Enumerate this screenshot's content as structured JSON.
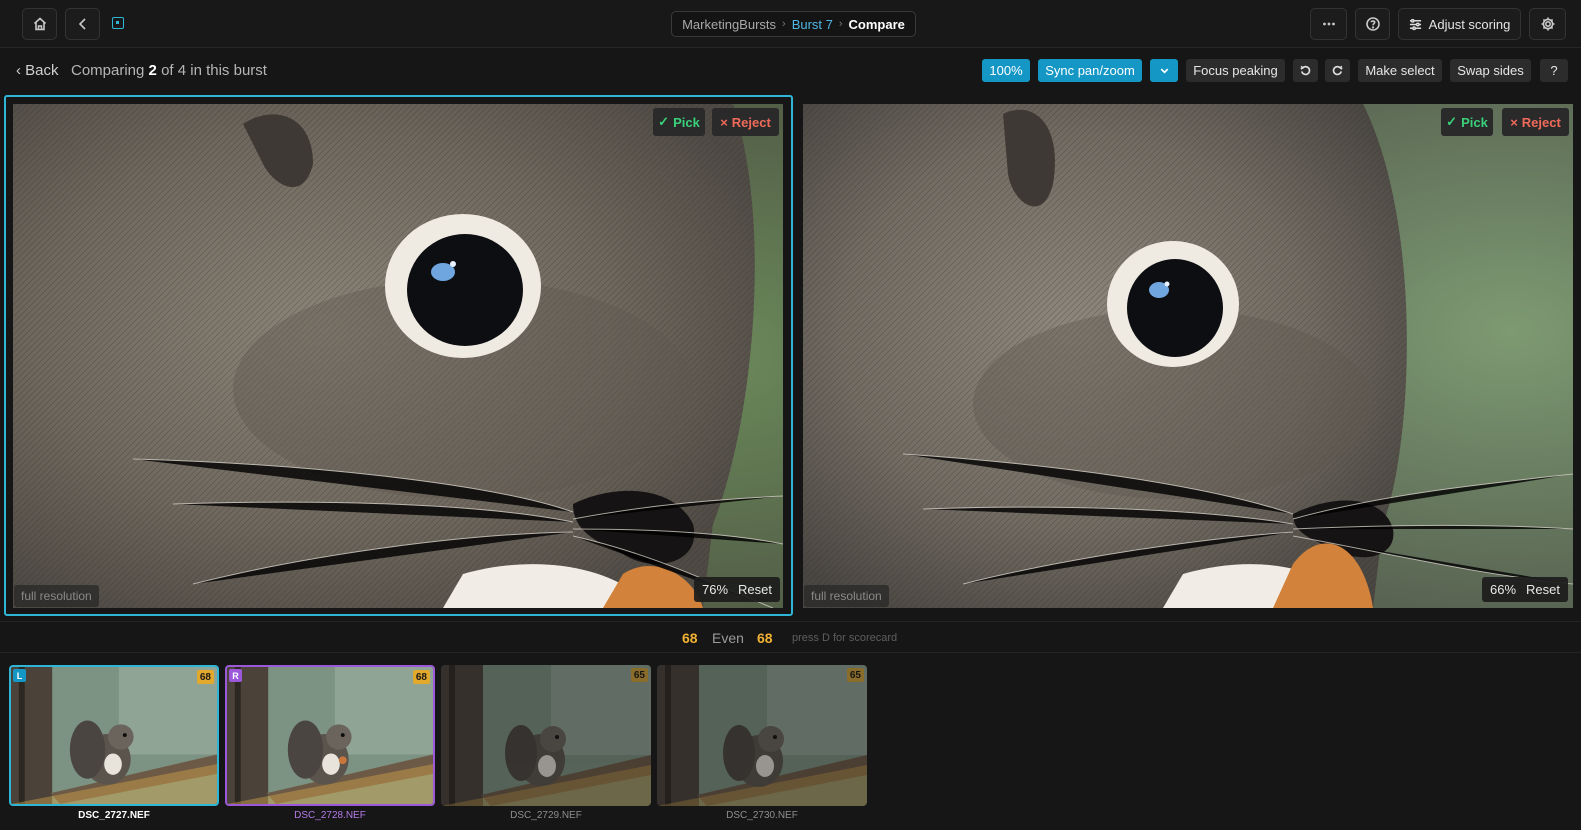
{
  "topbar": {
    "breadcrumb": [
      "MarketingBursts",
      "Burst 7",
      "Compare"
    ],
    "adjust_scoring": "Adjust scoring",
    "icons": [
      "home-icon",
      "back-arrow-icon",
      "app-logo-icon",
      "more-icon",
      "help-icon",
      "sliders-icon",
      "gear-icon"
    ]
  },
  "toolbar": {
    "back": "‹ Back",
    "comparing_prefix": "Comparing",
    "comparing_count": "2",
    "comparing_suffix": "of 4 in this burst",
    "zoom": "100%",
    "sync": "Sync pan/zoom",
    "focus_peaking": "Focus peaking",
    "make_select": "Make select",
    "swap_sides": "Swap sides",
    "help": "?"
  },
  "left_pane": {
    "pick": "Pick",
    "reject": "Reject",
    "resolution": "full resolution",
    "zoom": "76%",
    "reset": "Reset"
  },
  "right_pane": {
    "pick": "Pick",
    "reject": "Reject",
    "resolution": "full resolution",
    "zoom": "66%",
    "reset": "Reset"
  },
  "score_row": {
    "left_score": "68",
    "verdict": "Even",
    "right_score": "68",
    "hint": "press D for scorecard"
  },
  "filmstrip": [
    {
      "file": "DSC_2727.NEF",
      "score": "68",
      "side": "L"
    },
    {
      "file": "DSC_2728.NEF",
      "score": "68",
      "side": "R"
    },
    {
      "file": "DSC_2729.NEF",
      "score": "65",
      "side": ""
    },
    {
      "file": "DSC_2730.NEF",
      "score": "65",
      "side": ""
    }
  ],
  "colors": {
    "accent_blue": "#1597c6",
    "left_frame": "#2fb5d6",
    "right_frame": "#9b59d9",
    "score": "#f2b233",
    "pick": "#3ad07a",
    "reject": "#f06a5a"
  }
}
